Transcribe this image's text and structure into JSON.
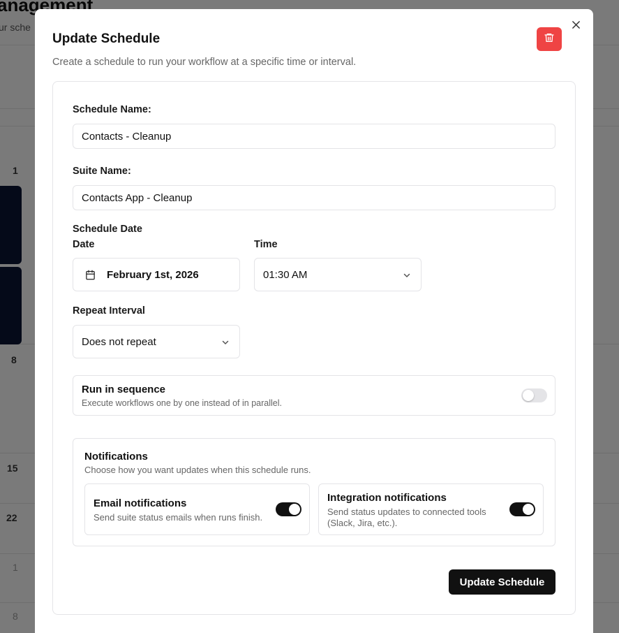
{
  "background": {
    "title": "anagement",
    "subtitle": "ur sche",
    "day_numbers": [
      "1",
      "8",
      "15",
      "22",
      "1",
      "8"
    ]
  },
  "modal": {
    "title": "Update Schedule",
    "description": "Create a schedule to run your workflow at a specific time or interval.",
    "delete_icon": "trash-icon",
    "close_icon": "close-icon",
    "form": {
      "schedule_name": {
        "label": "Schedule Name:",
        "value": "Contacts - Cleanup"
      },
      "suite_name": {
        "label": "Suite Name:",
        "value": "Contacts App - Cleanup"
      },
      "schedule_date_heading": "Schedule Date",
      "date": {
        "label": "Date",
        "value": "February 1st, 2026",
        "icon": "calendar-icon"
      },
      "time": {
        "label": "Time",
        "value": "01:30 AM",
        "icon": "chevron-down-icon"
      },
      "repeat": {
        "label": "Repeat Interval",
        "value": "Does not repeat",
        "icon": "chevron-down-icon"
      },
      "sequence": {
        "title": "Run in sequence",
        "description": "Execute workflows one by one instead of in parallel.",
        "enabled": false
      },
      "notifications": {
        "title": "Notifications",
        "description": "Choose how you want updates when this schedule runs.",
        "email": {
          "title": "Email notifications",
          "description": "Send suite status emails when runs finish.",
          "enabled": true
        },
        "integration": {
          "title": "Integration notifications",
          "description": "Send status updates to connected tools (Slack, Jira, etc.).",
          "enabled": true
        }
      },
      "submit_label": "Update Schedule"
    }
  },
  "colors": {
    "danger": "#ef4444",
    "primary": "#111111",
    "overlay": "rgba(0,0,0,0.5)",
    "calendar_event": "#0b1433"
  }
}
